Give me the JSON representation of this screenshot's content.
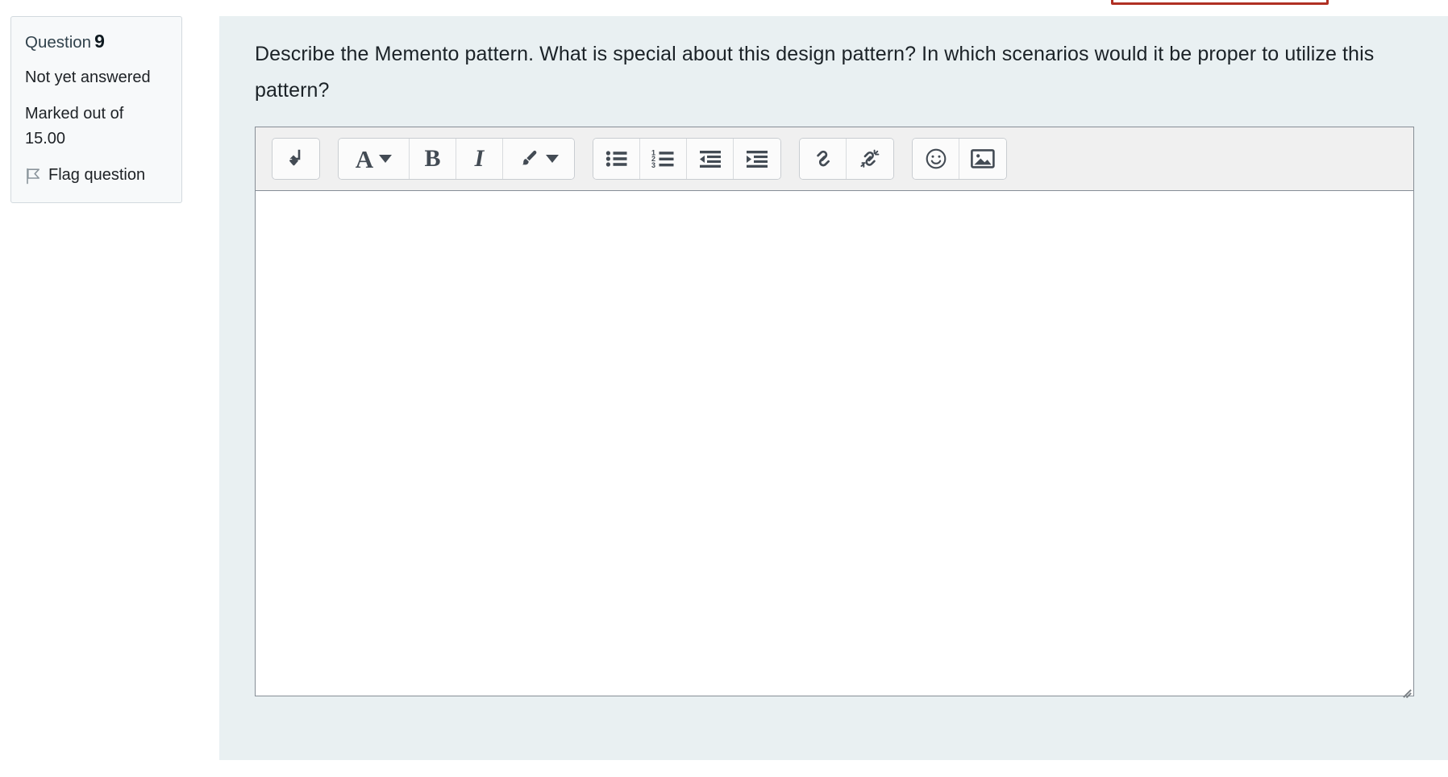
{
  "question_info": {
    "label": "Question",
    "number": "9",
    "state": "Not yet answered",
    "grade": "Marked out of 15.00",
    "flag_label": "Flag question",
    "flag_icon": "flag-outline-icon"
  },
  "question": {
    "text": "Describe the Memento pattern. What is special about this design pattern? In which scenarios would it be proper to utilize this pattern?"
  },
  "editor": {
    "content": "",
    "placeholder": "",
    "toolbar_groups": [
      {
        "name": "insert-group",
        "buttons": [
          {
            "name": "line-break-button",
            "icon": "line-break-arrow-icon",
            "label": "Insert line break"
          }
        ]
      },
      {
        "name": "style-group",
        "buttons": [
          {
            "name": "font-style-button",
            "icon": "font-style-A-icon",
            "label": "Paragraph styles"
          },
          {
            "name": "bold-button",
            "icon": "bold-B-icon",
            "label": "Bold"
          },
          {
            "name": "italic-button",
            "icon": "italic-I-icon",
            "label": "Italic"
          },
          {
            "name": "highlight-button",
            "icon": "paintbrush-icon",
            "label": "Text highlight colour"
          }
        ]
      },
      {
        "name": "list-group",
        "buttons": [
          {
            "name": "bulleted-list-button",
            "icon": "bulleted-list-icon",
            "label": "Unordered list"
          },
          {
            "name": "numbered-list-button",
            "icon": "numbered-list-icon",
            "label": "Ordered list"
          },
          {
            "name": "outdent-button",
            "icon": "outdent-icon",
            "label": "Decrease indent"
          },
          {
            "name": "indent-button",
            "icon": "indent-icon",
            "label": "Increase indent"
          }
        ]
      },
      {
        "name": "link-group",
        "buttons": [
          {
            "name": "link-button",
            "icon": "link-icon",
            "label": "Link"
          },
          {
            "name": "unlink-button",
            "icon": "unlink-icon",
            "label": "Unlink"
          }
        ]
      },
      {
        "name": "media-group",
        "buttons": [
          {
            "name": "emoji-button",
            "icon": "smiley-face-icon",
            "label": "Emoticon"
          },
          {
            "name": "image-button",
            "icon": "image-picture-icon",
            "label": "Image"
          }
        ]
      }
    ],
    "resize_handle": "resize-grip-icon"
  },
  "colors": {
    "panel_background": "#e9f0f2",
    "info_background": "#f7f9fa",
    "info_border": "#d2d9de",
    "toolbar_background": "#f0f0f0",
    "editor_border": "#868e96",
    "icon": "#434b54",
    "alert_border": "#b03023",
    "text": "#1d2125"
  },
  "top_alert": {
    "name": "top-alert-box",
    "border_color": "#b03023"
  }
}
